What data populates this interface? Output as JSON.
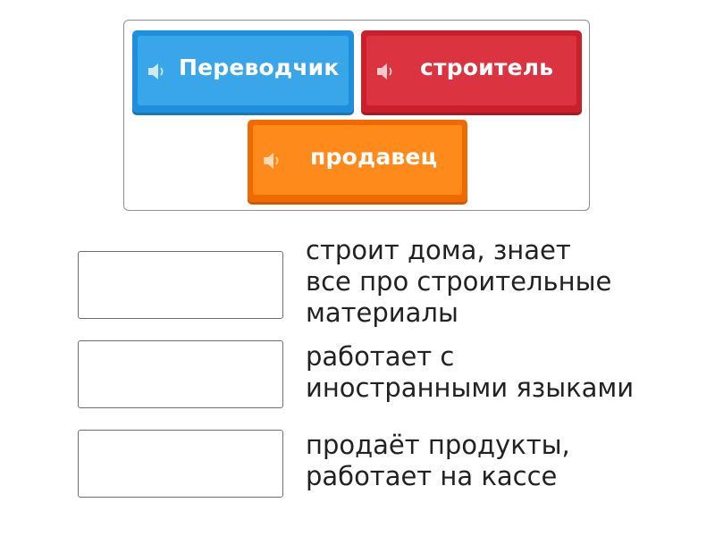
{
  "word_bank": {
    "tiles": [
      {
        "label": "Переводчик",
        "color": "#1e8fdc",
        "icon": "speaker-icon"
      },
      {
        "label": "строитель",
        "color": "#c9202b",
        "icon": "speaker-icon"
      },
      {
        "label": "продавец",
        "color": "#f16a00",
        "icon": "speaker-icon"
      }
    ]
  },
  "pairs": [
    {
      "definition_lines": [
        "строит дома, знает",
        "все про строительные",
        "материалы"
      ]
    },
    {
      "definition_lines": [
        "работает с",
        "иностранными языками"
      ]
    },
    {
      "definition_lines": [
        "продаёт продукты,",
        "работает на кассе"
      ]
    }
  ]
}
